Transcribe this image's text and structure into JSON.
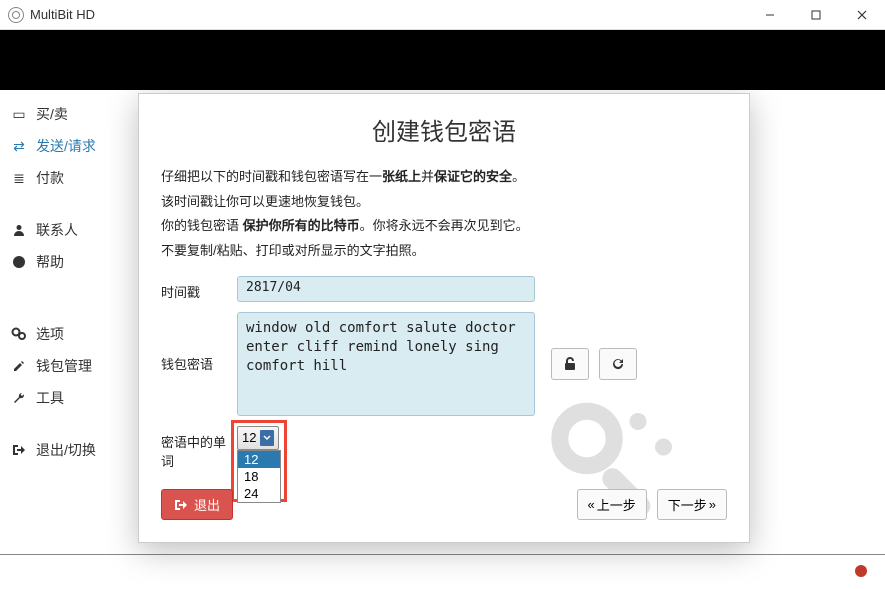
{
  "app": {
    "title": "MultiBit HD"
  },
  "window": {
    "min": "—",
    "max": "☐",
    "close": "✕"
  },
  "sidebar": {
    "items": [
      {
        "label": "买/卖"
      },
      {
        "label": "发送/请求"
      },
      {
        "label": "付款"
      },
      {
        "label": "联系人"
      },
      {
        "label": "帮助"
      },
      {
        "label": "选项"
      },
      {
        "label": "钱包管理"
      },
      {
        "label": "工具"
      },
      {
        "label": "退出/切换"
      }
    ]
  },
  "dialog": {
    "title": "创建钱包密语",
    "instr_pre1": "仔细把以下的时间戳和钱包密语写在一",
    "instr_bold1": "张纸上",
    "instr_mid1": "并",
    "instr_bold2": "保证它的安全",
    "instr_post1": "。",
    "line2": "该时间戳让你可以更速地恢复钱包。",
    "line3_pre": "你的钱包密语 ",
    "line3_bold": "保护你所有的比特币",
    "line3_post": "。你将永远不会再次见到它。",
    "line4": "不要复制/粘贴、打印或对所显示的文字拍照。",
    "timestamp_label": "时间戳",
    "timestamp_value": "2817/04",
    "seed_label": "钱包密语",
    "seed_value": "window old comfort salute doctor\nenter cliff remind lonely sing\ncomfort hill",
    "wordcount_label": "密语中的单词",
    "wordcount_value": "12",
    "wordcount_options": [
      "12",
      "18",
      "24"
    ],
    "exit_label": "退出",
    "prev_label": "上一步",
    "next_label": "下一步"
  }
}
